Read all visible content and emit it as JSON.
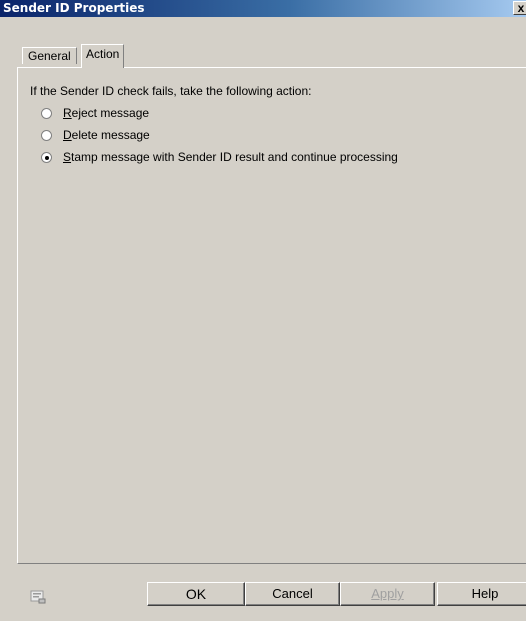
{
  "window": {
    "title": "Sender ID Properties",
    "close_label": "x"
  },
  "tabs": [
    {
      "label": "General",
      "active": false
    },
    {
      "label": "Action",
      "active": true
    }
  ],
  "action": {
    "prompt": "If the Sender ID check fails, take the following action:",
    "options": [
      {
        "label_accel": "R",
        "label_rest": "eject message",
        "selected": false
      },
      {
        "label_accel": "D",
        "label_rest": "elete message",
        "selected": false
      },
      {
        "label_accel": "S",
        "label_rest": "tamp message with Sender ID result and continue processing",
        "selected": true
      }
    ]
  },
  "buttons": {
    "ok": "OK",
    "cancel": "Cancel",
    "apply": "Apply",
    "help": "Help"
  }
}
